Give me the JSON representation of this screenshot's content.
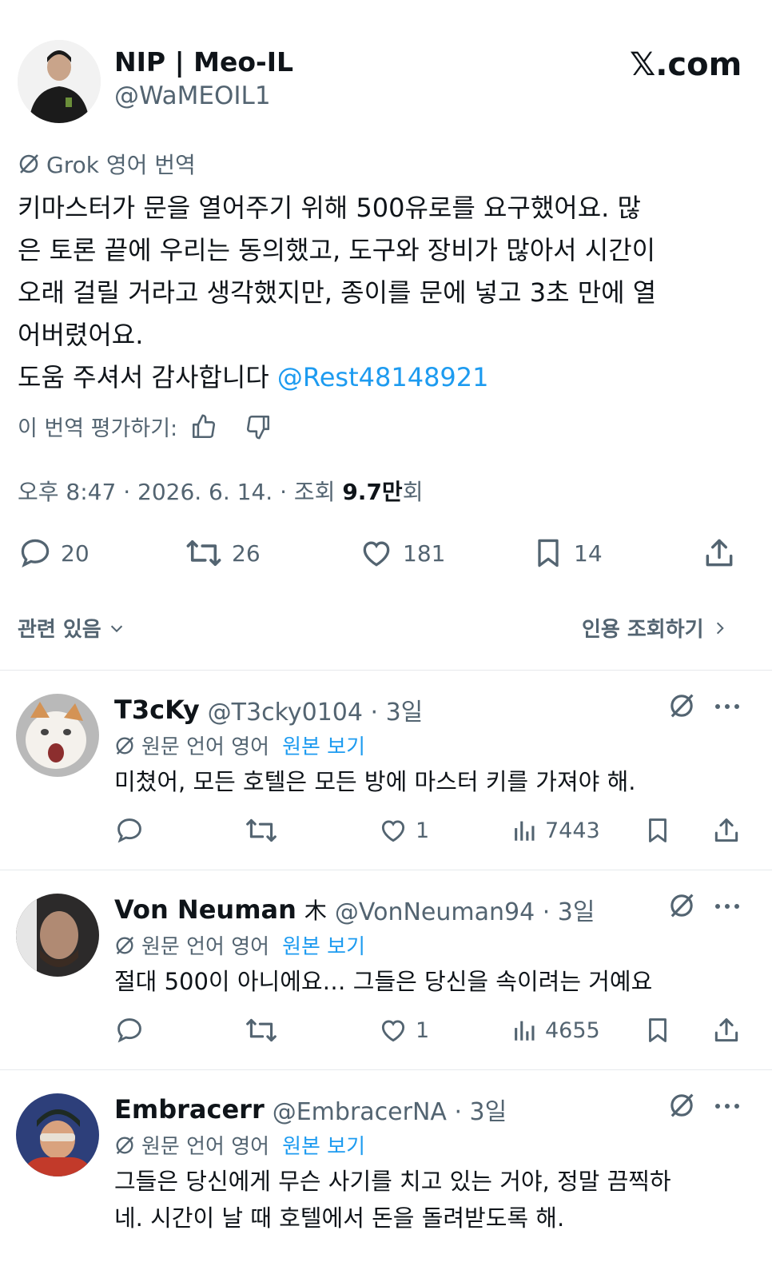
{
  "header": {
    "name": "NIP | Meo-IL",
    "handle": "@WaMEOIL1",
    "brand": "𝕏.com"
  },
  "translation_label": "Grok 영어 번역",
  "tweet": {
    "lines": [
      "키마스터가 문을 열어주기 위해 500유로를 요구했어요. 많",
      "은 토론 끝에 우리는 동의했고, 도구와 장비가 많아서 시간이",
      "오래 걸릴 거라고 생각했지만, 종이를 문에 넣고 3초 만에 열",
      "어버렸어요."
    ],
    "thanks": "도움 주셔서 감사합니다",
    "mention": "@Rest48148921"
  },
  "rate_label": "이 번역 평가하기:",
  "meta": {
    "time": "오후 8:47 · 2026. 6. 14. · 조회 ",
    "views": "9.7만",
    "views_suffix": "회"
  },
  "actions": {
    "replies": "20",
    "reposts": "26",
    "likes": "181",
    "bookmarks": "14"
  },
  "related": {
    "label": "관련 있음",
    "quotes": "인용 조회하기"
  },
  "replies": [
    {
      "name": "T3cKy",
      "badge": "",
      "handle": "@T3cky0104 · 3일",
      "trans": "원문 언어 영어",
      "show_original": "원본 보기",
      "text": [
        "미쳤어, 모든 호텔은 모든 방에 마스터 키를 가져야 해."
      ],
      "likes": "1",
      "views": "7443"
    },
    {
      "name": "Von Neuman",
      "badge": "⽊",
      "handle": "@VonNeuman94 · 3일",
      "trans": "원문 언어 영어",
      "show_original": "원본 보기",
      "text": [
        "절대 500이 아니에요… 그들은 당신을 속이려는 거예요"
      ],
      "likes": "1",
      "views": "4655"
    },
    {
      "name": "Embracerr",
      "badge": "",
      "handle": "@EmbracerNA · 3일",
      "trans": "원문 언어 영어",
      "show_original": "원본 보기",
      "text": [
        "그들은 당신에게 무슨 사기를 치고 있는 거야, 정말 끔찍하",
        "네. 시간이 날 때 호텔에서 돈을 돌려받도록 해."
      ]
    }
  ],
  "icons": {
    "reply": "speech-bubble-icon",
    "repost": "repost-arrows-icon",
    "like": "heart-icon",
    "bookmark": "bookmark-icon",
    "share": "share-upload-icon",
    "views": "bar-chart-icon",
    "grok": "grok-slash-circle-icon",
    "more": "more-dots-icon"
  },
  "colors": {
    "text": "#0f1419",
    "muted": "#536471",
    "link": "#1d9bf0",
    "divider": "#e6e9ec"
  }
}
